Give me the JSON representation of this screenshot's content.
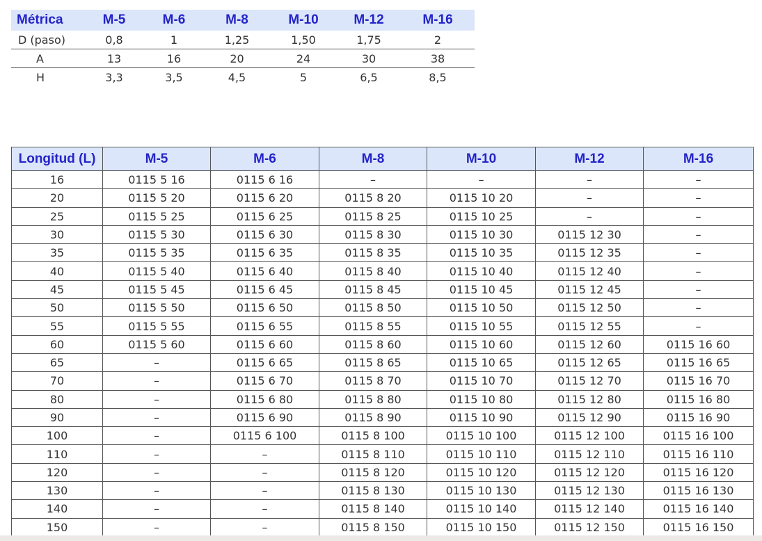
{
  "spec_table": {
    "headers": [
      "Métrica",
      "M-5",
      "M-6",
      "M-8",
      "M-10",
      "M-12",
      "M-16"
    ],
    "rows": [
      [
        "D (paso)",
        "0,8",
        "1",
        "1,25",
        "1,50",
        "1,75",
        "2"
      ],
      [
        "A",
        "13",
        "16",
        "20",
        "24",
        "30",
        "38"
      ],
      [
        "H",
        "3,3",
        "3,5",
        "4,5",
        "5",
        "6,5",
        "8,5"
      ]
    ]
  },
  "length_table": {
    "headers": [
      "Longitud (L)",
      "M-5",
      "M-6",
      "M-8",
      "M-10",
      "M-12",
      "M-16"
    ],
    "rows": [
      [
        "16",
        "0115 5 16",
        "0115 6 16",
        "–",
        "–",
        "–",
        "–"
      ],
      [
        "20",
        "0115 5 20",
        "0115 6 20",
        "0115 8 20",
        "0115 10 20",
        "–",
        "–"
      ],
      [
        "25",
        "0115 5 25",
        "0115 6 25",
        "0115 8 25",
        "0115 10 25",
        "–",
        "–"
      ],
      [
        "30",
        "0115 5 30",
        "0115 6 30",
        "0115 8 30",
        "0115 10 30",
        "0115 12 30",
        "–"
      ],
      [
        "35",
        "0115 5 35",
        "0115 6 35",
        "0115 8 35",
        "0115 10 35",
        "0115 12 35",
        "–"
      ],
      [
        "40",
        "0115 5 40",
        "0115 6 40",
        "0115 8 40",
        "0115 10 40",
        "0115 12 40",
        "–"
      ],
      [
        "45",
        "0115 5 45",
        "0115 6 45",
        "0115 8 45",
        "0115 10 45",
        "0115 12 45",
        "–"
      ],
      [
        "50",
        "0115 5 50",
        "0115 6 50",
        "0115 8 50",
        "0115 10 50",
        "0115 12 50",
        "–"
      ],
      [
        "55",
        "0115 5 55",
        "0115 6 55",
        "0115 8 55",
        "0115 10 55",
        "0115 12 55",
        "–"
      ],
      [
        "60",
        "0115 5 60",
        "0115 6 60",
        "0115 8 60",
        "0115 10 60",
        "0115 12 60",
        "0115 16 60"
      ],
      [
        "65",
        "–",
        "0115 6 65",
        "0115 8 65",
        "0115 10 65",
        "0115 12 65",
        "0115 16 65"
      ],
      [
        "70",
        "–",
        "0115 6 70",
        "0115 8 70",
        "0115 10 70",
        "0115 12 70",
        "0115 16 70"
      ],
      [
        "80",
        "–",
        "0115 6 80",
        "0115 8 80",
        "0115 10 80",
        "0115 12 80",
        "0115 16 80"
      ],
      [
        "90",
        "–",
        "0115 6 90",
        "0115 8 90",
        "0115 10 90",
        "0115 12 90",
        "0115 16 90"
      ],
      [
        "100",
        "–",
        "0115 6 100",
        "0115 8 100",
        "0115 10 100",
        "0115 12 100",
        "0115 16 100"
      ],
      [
        "110",
        "–",
        "–",
        "0115 8 110",
        "0115 10 110",
        "0115 12 110",
        "0115 16 110"
      ],
      [
        "120",
        "–",
        "–",
        "0115 8 120",
        "0115 10 120",
        "0115 12 120",
        "0115 16 120"
      ],
      [
        "130",
        "–",
        "–",
        "0115 8 130",
        "0115 10 130",
        "0115 12 130",
        "0115 16 130"
      ],
      [
        "140",
        "–",
        "–",
        "0115 8 140",
        "0115 10 140",
        "0115 12 140",
        "0115 16 140"
      ],
      [
        "150",
        "–",
        "–",
        "0115 8 150",
        "0115 10 150",
        "0115 12 150",
        "0115 16 150"
      ]
    ]
  },
  "colors": {
    "header_bg": "#dce6fa",
    "header_text": "#2424c8",
    "border": "#555555"
  }
}
